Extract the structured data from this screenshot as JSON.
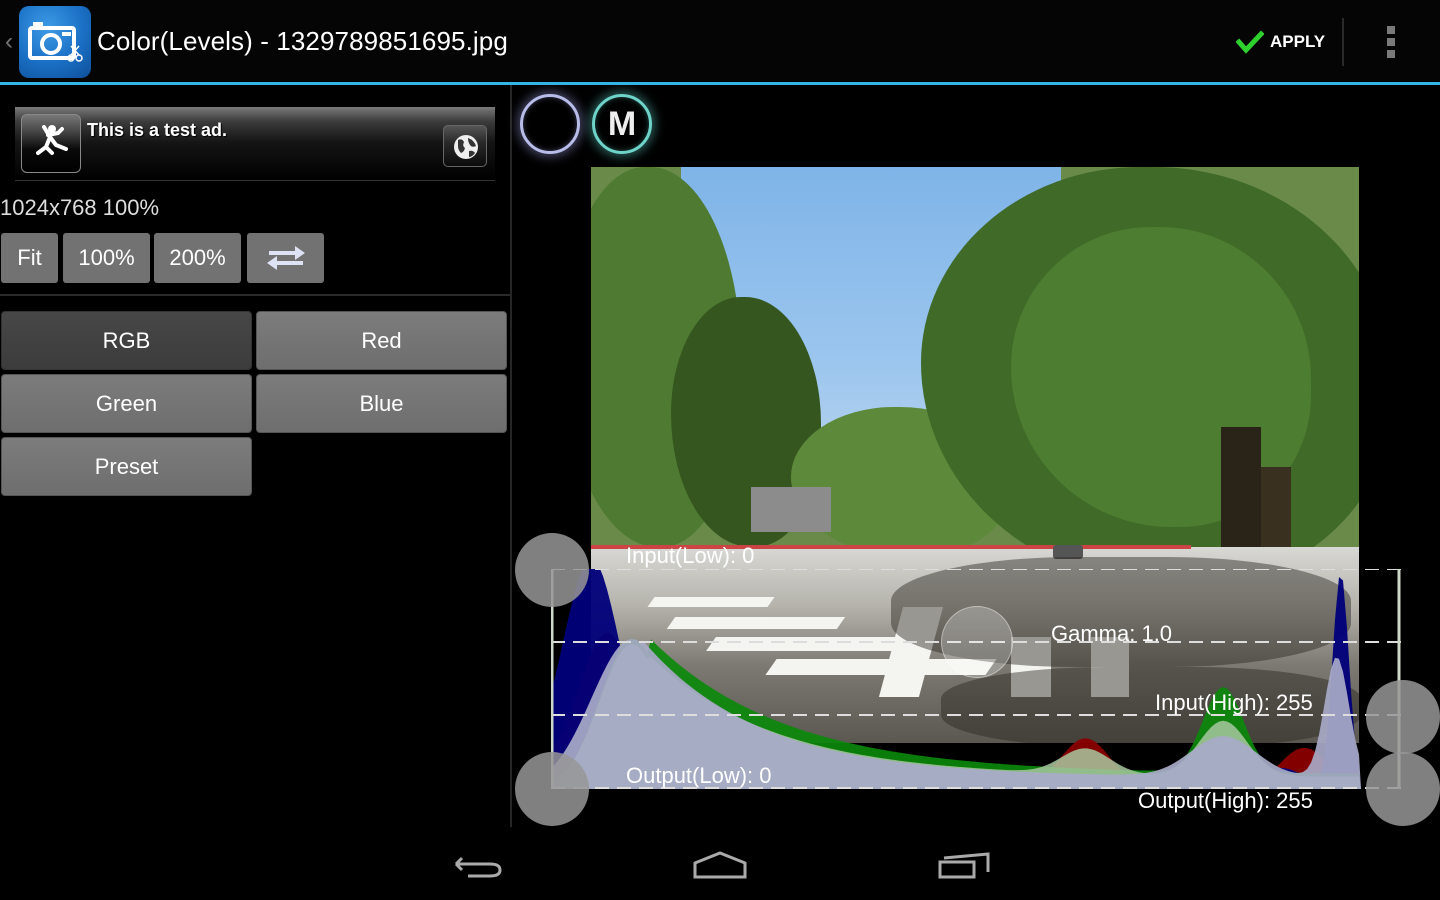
{
  "actionbar": {
    "title": "Color(Levels) - 1329789851695.jpg",
    "apply_label": "APPLY",
    "accent_color": "#33b5e5",
    "icons": {
      "app": "camera-scissors-icon",
      "apply": "checkmark-icon",
      "overflow": "overflow-menu-icon",
      "up": "chevron-left-icon"
    }
  },
  "ad": {
    "text": "This is a test ad.",
    "icons": {
      "left": "running-man-icon",
      "right": "globe-icon"
    }
  },
  "image_info": "1024x768 100%",
  "zoom_buttons": [
    {
      "label": "Fit"
    },
    {
      "label": "100%"
    },
    {
      "label": "200%"
    },
    {
      "label": "",
      "icon": "swap-arrows-icon"
    }
  ],
  "channel_buttons": [
    {
      "label": "RGB",
      "selected": true
    },
    {
      "label": "Red",
      "selected": false
    },
    {
      "label": "Green",
      "selected": false
    },
    {
      "label": "Blue",
      "selected": false
    },
    {
      "label": "Preset",
      "selected": false
    }
  ],
  "modes": [
    {
      "label": "",
      "name": "mode-off"
    },
    {
      "label": "M",
      "name": "mode-manual"
    }
  ],
  "levels": {
    "input_low": "Input(Low): 0",
    "gamma": "Gamma: 1.0",
    "input_high": "Input(High): 255",
    "output_low": "Output(Low): 0",
    "output_high": "Output(High): 255"
  },
  "histogram_colors": {
    "red": "#8a0000",
    "green": "#0a8a0a",
    "blue": "#00007a",
    "luma": "#a8aac8"
  },
  "navbar": {
    "icons": [
      "back-icon",
      "home-icon",
      "recent-apps-icon"
    ]
  }
}
